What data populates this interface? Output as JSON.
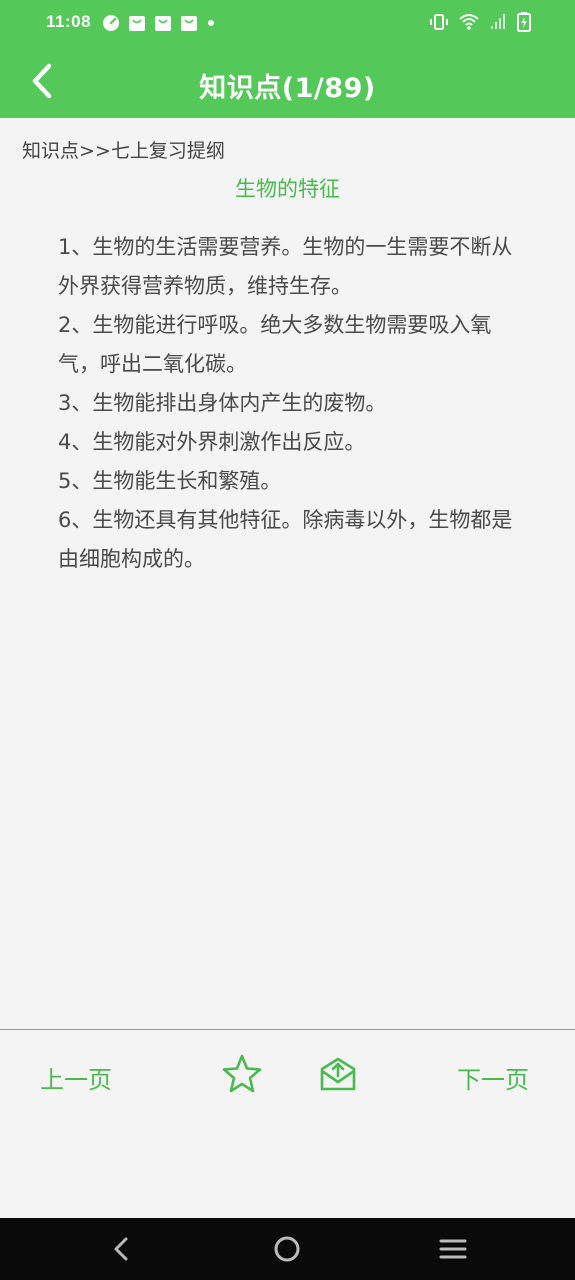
{
  "status_bar": {
    "time": "11:08"
  },
  "app_bar": {
    "title": "知识点(1/89)"
  },
  "breadcrumb": "知识点>>七上复习提纲",
  "section_title": "生物的特征",
  "paragraphs": [
    "1、生物的生活需要营养。生物的一生需要不断从外界获得营养物质，维持生存。",
    "2、生物能进行呼吸。绝大多数生物需要吸入氧气，呼出二氧化碳。",
    "3、生物能排出身体内产生的废物。",
    "4、生物能对外界刺激作出反应。",
    "5、生物能生长和繁殖。",
    "6、生物还具有其他特征。除病毒以外，生物都是由细胞构成的。"
  ],
  "bottom_bar": {
    "prev_label": "上一页",
    "next_label": "下一页",
    "star_icon": "star-outline-icon",
    "share_icon": "mail-share-icon"
  },
  "colors": {
    "accent": "#55c85a",
    "text_accent": "#48bb4e",
    "body_text": "#4a4a4a",
    "background": "#f4f4f4"
  }
}
